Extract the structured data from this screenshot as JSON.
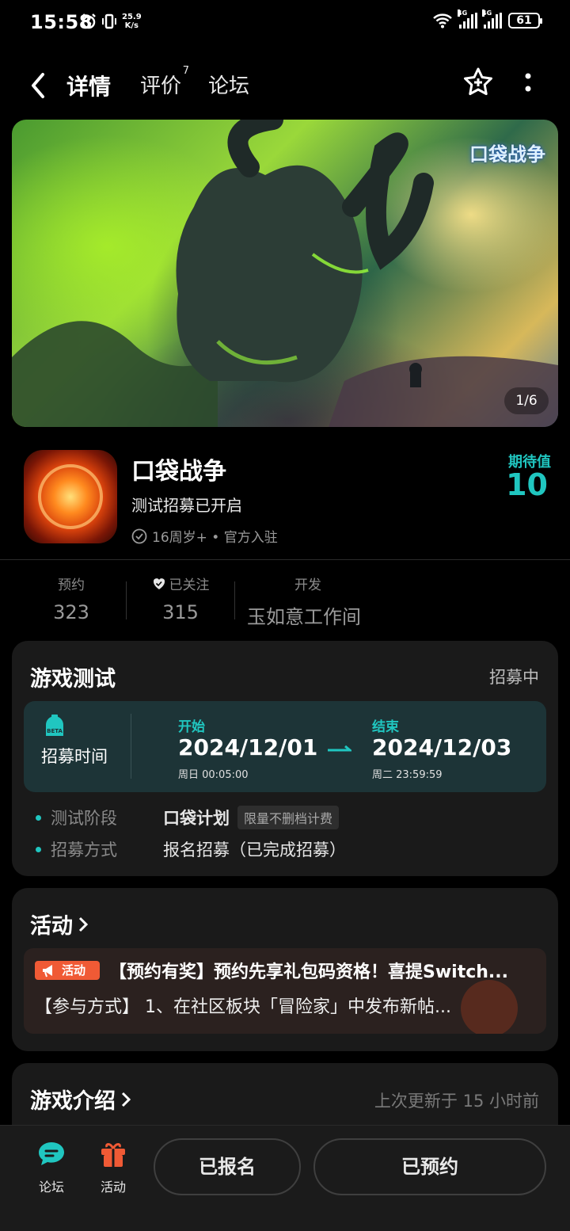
{
  "status_bar": {
    "time": "15:58",
    "net_speed": "25.9",
    "net_speed_unit": "K/s",
    "sim1": "4G",
    "sim2": "4G",
    "battery": "61"
  },
  "nav": {
    "tab_detail": "详情",
    "tab_reviews": "评价",
    "review_count": "7",
    "tab_forum": "论坛"
  },
  "banner": {
    "logo_text": "口袋战争",
    "pager": "1/6"
  },
  "app": {
    "name": "口袋战争",
    "subtitle": "测试招募已开启",
    "meta": "16周岁+ • 官方入驻",
    "expect_label": "期待值",
    "expect_value": "10"
  },
  "stats": {
    "reserve_label": "预约",
    "reserve_value": "323",
    "follow_label": "已关注",
    "follow_value": "315",
    "dev_label": "开发",
    "dev_value": "玉如意工作间"
  },
  "test_card": {
    "title": "游戏测试",
    "status": "招募中",
    "beta_icon_text": "BETA",
    "recruit_label": "招募时间",
    "start_label": "开始",
    "start_date": "2024/12/01",
    "start_day": "周日  00:05:00",
    "end_label": "结束",
    "end_date": "2024/12/03",
    "end_day": "周二  23:59:59",
    "phase_label": "测试阶段",
    "phase_value": "口袋计划",
    "phase_chip": "限量不删档计费",
    "method_label": "招募方式",
    "method_value": "报名招募（已完成招募）"
  },
  "activity_card": {
    "title": "活动",
    "badge": "活动",
    "line1": "【预约有奖】预约先享礼包码资格！喜提Switch...",
    "line2": "【参与方式】 1、在社区板块「冒险家」中发布新帖..."
  },
  "intro_card": {
    "title": "游戏介绍",
    "updated": "上次更新于 15 小时前"
  },
  "bottom": {
    "forum_label": "论坛",
    "activity_label": "活动",
    "signed_up": "已报名",
    "reserved": "已预约"
  },
  "colors": {
    "accent": "#20c6c0",
    "orange": "#f05a35",
    "card_bg": "#1a1a1a"
  }
}
